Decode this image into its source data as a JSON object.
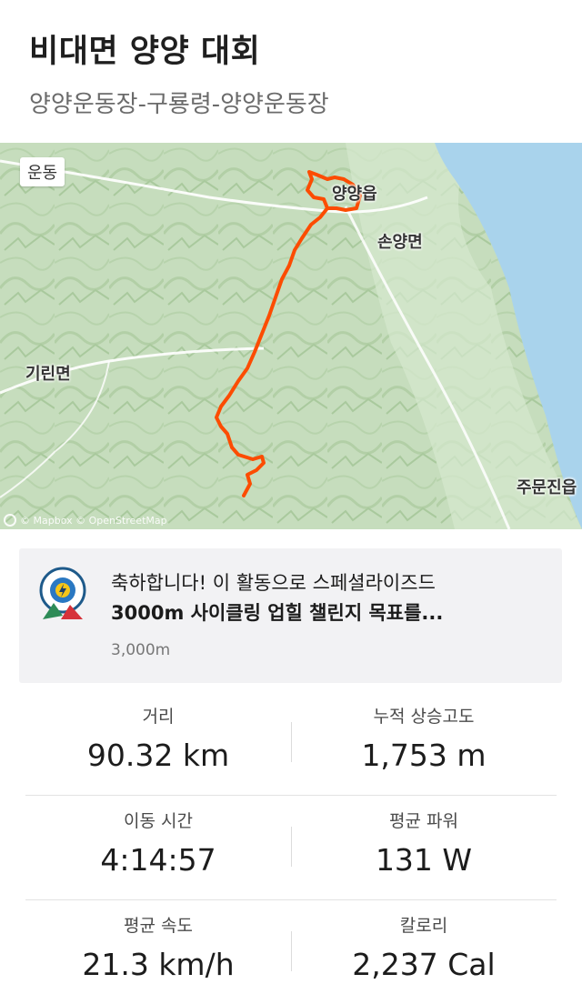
{
  "activity": {
    "title": "비대면 양양 대회",
    "route": "양양운동장-구룡령-양양운동장"
  },
  "map": {
    "badge": "운동",
    "labels": {
      "yangyang": "양양읍",
      "sonyang": "손양면",
      "girin": "기린면",
      "jumunjin": "주문진읍"
    },
    "attribution": "© Mapbox © OpenStreetMap",
    "route_color": "#fc4c02"
  },
  "challenge": {
    "line1": "축하합니다! 이 활동으로 스페셜라이즈드",
    "line2": "3000m 사이클링 업힐 챌린지 목표를...",
    "sub": "3,000m"
  },
  "stats": [
    {
      "left": {
        "label": "거리",
        "value": "90.32 km"
      },
      "right": {
        "label": "누적 상승고도",
        "value": "1,753 m"
      }
    },
    {
      "left": {
        "label": "이동 시간",
        "value": "4:14:57"
      },
      "right": {
        "label": "평균 파워",
        "value": "131 W"
      }
    },
    {
      "left": {
        "label": "평균 속도",
        "value": "21.3 km/h"
      },
      "right": {
        "label": "칼로리",
        "value": "2,237 Cal"
      }
    }
  ]
}
